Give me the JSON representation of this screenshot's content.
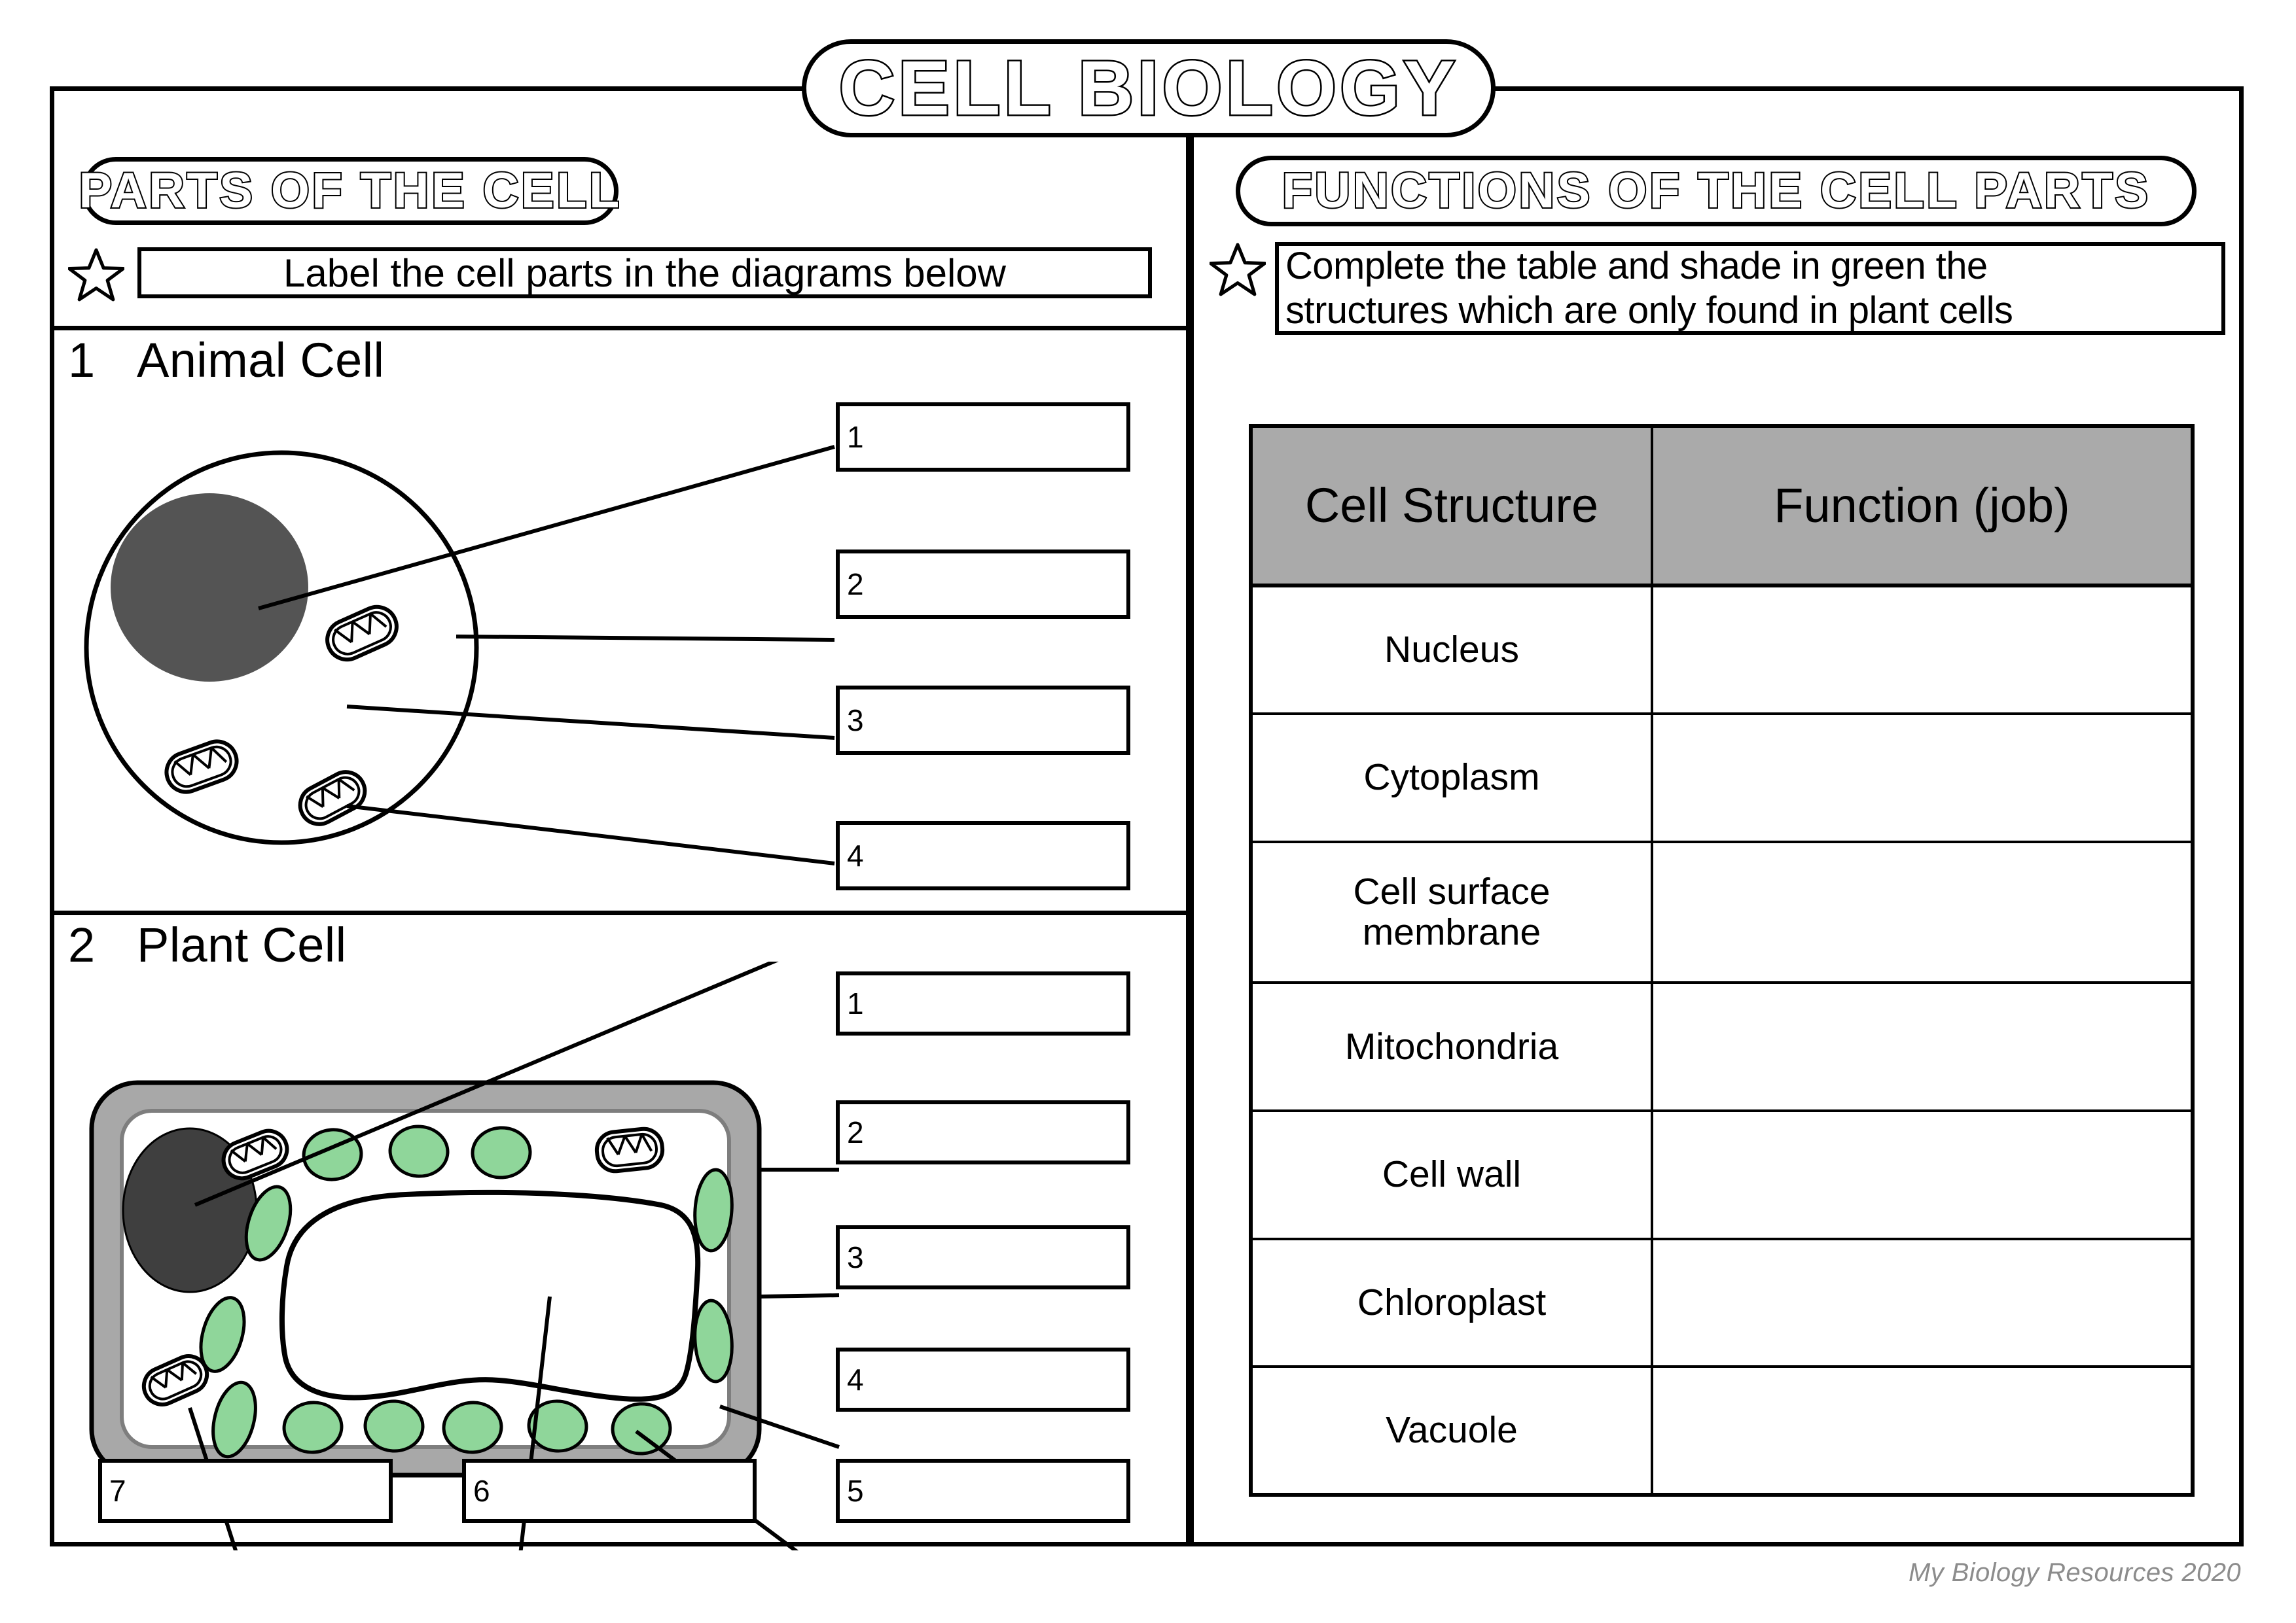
{
  "worksheet": {
    "title": "CELL BIOLOGY",
    "footer": "My Biology Resources 2020"
  },
  "left_panel": {
    "header": "PARTS OF THE CELL",
    "star_icon": "star-icon",
    "instruction": "Label the cell parts in the diagrams below",
    "questions": [
      {
        "number": "1",
        "title": "Animal Cell",
        "diagram": "animal-cell-diagram",
        "answer_boxes": [
          {
            "number": "1",
            "value": ""
          },
          {
            "number": "2",
            "value": ""
          },
          {
            "number": "3",
            "value": ""
          },
          {
            "number": "4",
            "value": ""
          }
        ]
      },
      {
        "number": "2",
        "title": "Plant Cell",
        "diagram": "plant-cell-diagram",
        "answer_boxes": [
          {
            "number": "1",
            "value": ""
          },
          {
            "number": "2",
            "value": ""
          },
          {
            "number": "3",
            "value": ""
          },
          {
            "number": "4",
            "value": ""
          },
          {
            "number": "5",
            "value": ""
          },
          {
            "number": "6",
            "value": ""
          },
          {
            "number": "7",
            "value": ""
          }
        ]
      }
    ]
  },
  "right_panel": {
    "header": "FUNCTIONS OF THE CELL PARTS",
    "star_icon": "star-icon",
    "instruction_line1": "Complete the table and shade in green the",
    "instruction_line2": "structures which are only found in plant cells",
    "table": {
      "columns": [
        "Cell Structure",
        "Function (job)"
      ],
      "rows": [
        {
          "structure": "Nucleus",
          "function": ""
        },
        {
          "structure": "Cytoplasm",
          "function": ""
        },
        {
          "structure": "Cell surface membrane",
          "structure_line1": "Cell surface",
          "structure_line2": "membrane",
          "function": ""
        },
        {
          "structure": "Mitochondria",
          "function": ""
        },
        {
          "structure": "Cell wall",
          "function": ""
        },
        {
          "structure": "Chloroplast",
          "function": ""
        },
        {
          "structure": "Vacuole",
          "function": ""
        }
      ]
    }
  },
  "colors": {
    "chloroplast_green": "#8fd69a",
    "nucleus_gray": "#545454",
    "cell_wall_gray": "#a8a8a8",
    "table_header_gray": "#aaaaaa",
    "footer_gray": "#8c8c8c",
    "outline_black": "#000000"
  }
}
